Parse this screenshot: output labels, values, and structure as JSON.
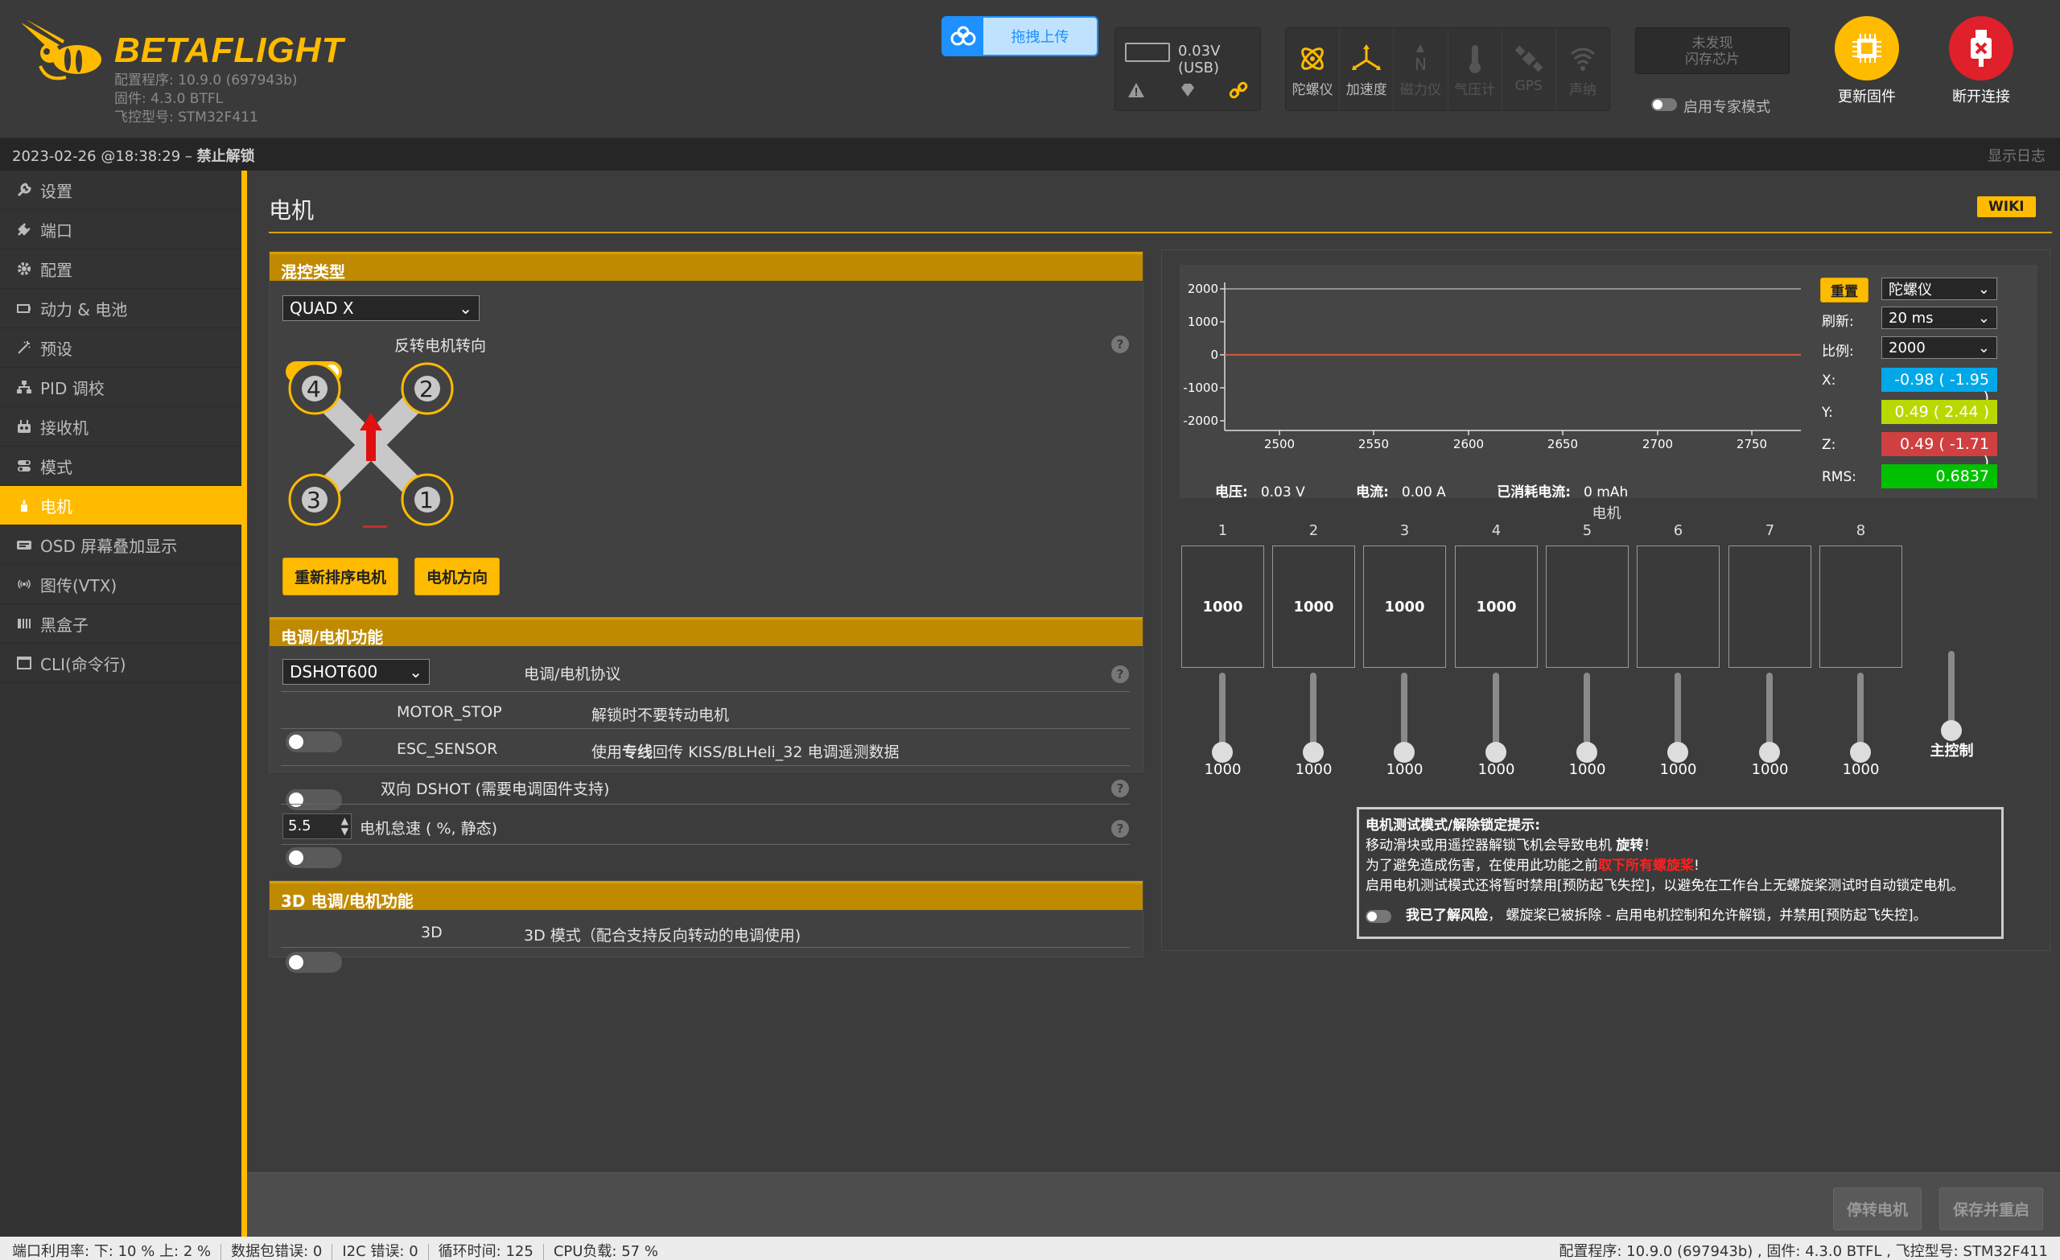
{
  "header": {
    "brand": "BETAFLIGHT",
    "configurator": "配置程序: 10.9.0 (697943b)",
    "firmware": "固件: 4.3.0 BTFL",
    "board": "飞控型号: STM32F411",
    "upload_label": "拖拽上传",
    "voltage": "0.03V (USB)",
    "flash_line1": "未发现",
    "flash_line2": "闪存芯片",
    "expert_mode": "启用专家模式",
    "update_fw": "更新固件",
    "disconnect": "断开连接",
    "sensors": [
      "陀螺仪",
      "加速度",
      "磁力仪",
      "气压计",
      "GPS",
      "声纳"
    ]
  },
  "status_top": {
    "datetime": "2023-02-26 @18:38:29",
    "separator": " – ",
    "arming": "禁止解锁",
    "show_log": "显示日志"
  },
  "sidebar": {
    "items": [
      {
        "label": "设置"
      },
      {
        "label": "端口"
      },
      {
        "label": "配置"
      },
      {
        "label": "动力 & 电池"
      },
      {
        "label": "预设"
      },
      {
        "label": "PID 调校"
      },
      {
        "label": "接收机"
      },
      {
        "label": "模式"
      },
      {
        "label": "电机"
      },
      {
        "label": "OSD 屏幕叠加显示"
      },
      {
        "label": "图传(VTX)"
      },
      {
        "label": "黑盒子"
      },
      {
        "label": "CLI(命令行)"
      }
    ]
  },
  "page": {
    "title": "电机",
    "wiki": "WIKI"
  },
  "mixer": {
    "head": "混控类型",
    "type": "QUAD X",
    "reverse_label": "反转电机转向",
    "reverse_on": true,
    "motor_nums": [
      "4",
      "2",
      "3",
      "1"
    ],
    "btn_reorder": "重新排序电机",
    "btn_direction": "电机方向"
  },
  "esc": {
    "head": "电调/电机功能",
    "protocol": "DSHOT600",
    "protocol_label": "电调/电机协议",
    "rows": [
      {
        "name": "MOTOR_STOP",
        "desc": "解锁时不要转动电机"
      },
      {
        "name": "ESC_SENSOR",
        "desc_pre": "使用",
        "desc_bold": "专线",
        "desc_post": "回传 KISS/BLHeli_32 电调遥测数据"
      }
    ],
    "bidir": "双向 DSHOT (需要电调固件支持)",
    "idle_value": "5.5",
    "idle_label": "电机怠速 ( %, 静态)"
  },
  "esc3d": {
    "head": "3D 电调/电机功能",
    "name": "3D",
    "desc": "3D 模式（配合支持反向转动的电调使用)"
  },
  "graph": {
    "yticks": [
      "2000",
      "1000",
      "0",
      "-1000",
      "-2000"
    ],
    "xticks": [
      "2500",
      "2550",
      "2600",
      "2650",
      "2700",
      "2750"
    ],
    "reset": "重置",
    "sensor": "陀螺仪",
    "refresh_label": "刷新:",
    "refresh": "20 ms",
    "scale_label": "比例:",
    "scale": "2000",
    "x_label": "X:",
    "x_val": "-0.98 ( -1.95 )",
    "y_label": "Y:",
    "y_val": "0.49 ( 2.44 )",
    "z_label": "Z:",
    "z_val": "0.49 ( -1.71 )",
    "rms_label": "RMS:",
    "rms_val": "0.6837",
    "voltage_label": "电压:",
    "voltage": "0.03 V",
    "current_label": "电流:",
    "current": "0.00 A",
    "mah_label": "已消耗电流:",
    "mah": "0 mAh",
    "colors": {
      "x": "#00a8e8",
      "y": "#b8d800",
      "z": "#d04040",
      "rms": "#00c000"
    }
  },
  "motors": {
    "title": "电机",
    "numbers": [
      "1",
      "2",
      "3",
      "4",
      "5",
      "6",
      "7",
      "8"
    ],
    "box_values": [
      "1000",
      "1000",
      "1000",
      "1000",
      "",
      "",
      "",
      ""
    ],
    "slider_values": [
      "1000",
      "1000",
      "1000",
      "1000",
      "1000",
      "1000",
      "1000",
      "1000"
    ],
    "master": "主控制"
  },
  "warning": {
    "title": "电机测试模式/解除锁定提示:",
    "line1_pre": "移动滑块或用遥控器解锁飞机会导致电机 ",
    "line1_bold": "旋转",
    "line1_post": "！",
    "line2_pre": "为了避免造成伤害，在使用此功能之前",
    "line2_red": "取下所有螺旋桨",
    "line2_post": "!",
    "line3": "启用电机测试模式还将暂时禁用[预防起飞失控]，以避免在工作台上无螺旋桨测试时自动锁定电机。",
    "ack_bold": "我已了解风险",
    "ack_rest": "，  螺旋桨已被拆除 - 启用电机控制和允许解锁，并禁用[预防起飞失控]。"
  },
  "actions": {
    "stop": "停转电机",
    "save": "保存并重启"
  },
  "footer": {
    "port_util": "端口利用率:",
    "down_up": "下: 10 % 上: 2 %",
    "packet_err": "数据包错误: 0",
    "i2c_err": "I2C 错误: 0",
    "cycle": "循环时间: 125",
    "cpu": "CPU负载: 57 %",
    "right": "配置程序: 10.9.0 (697943b) , 固件: 4.3.0 BTFL , 飞控型号: STM32F411"
  }
}
